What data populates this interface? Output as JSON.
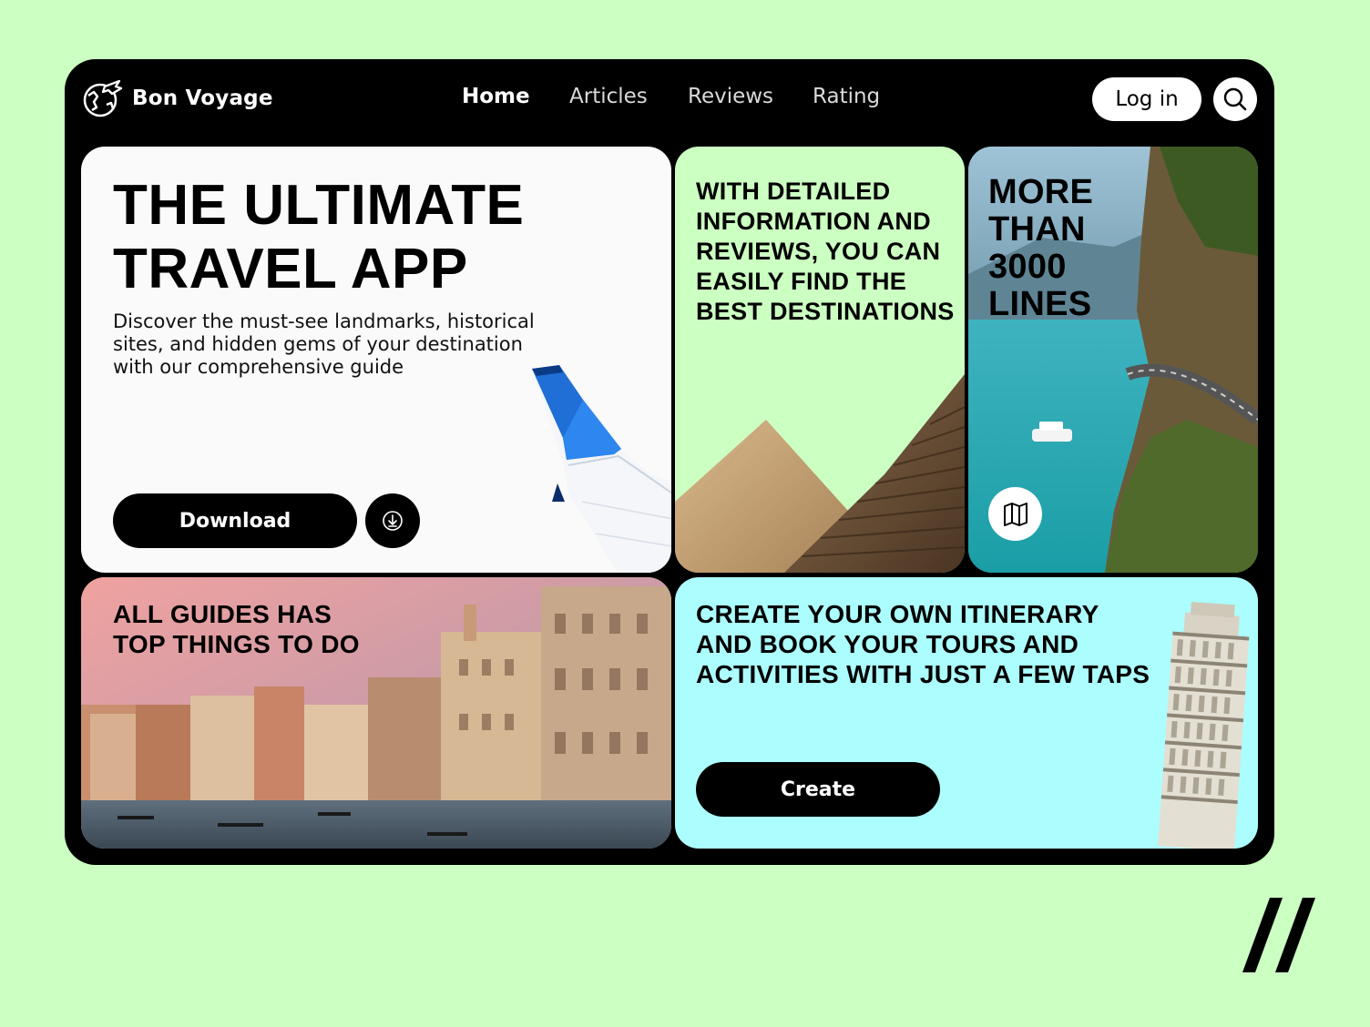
{
  "brand": {
    "name": "Bon Voyage",
    "logo_icon": "globe-plane-icon"
  },
  "nav": {
    "items": [
      {
        "label": "Home",
        "active": true
      },
      {
        "label": "Articles",
        "active": false
      },
      {
        "label": "Reviews",
        "active": false
      },
      {
        "label": "Rating",
        "active": false
      }
    ],
    "login_label": "Log in",
    "search_icon": "search-icon"
  },
  "hero": {
    "title_line1": "THE ULTIMATE",
    "title_line2": "TRAVEL APP",
    "description": "Discover the must-see landmarks, historical sites, and hidden gems of your destination with our comprehensive guide",
    "download_label": "Download",
    "download_icon": "download-icon",
    "image": "airplane-wing"
  },
  "info_card": {
    "text": "WITH DETAILED INFORMATION AND REVIEWS, YOU CAN EASILY FIND THE BEST DESTINATIONS",
    "image": "pyramids"
  },
  "lines_card": {
    "text_line1": "MORE",
    "text_line2": "THAN",
    "text_line3": "3000",
    "text_line4": "LINES",
    "map_icon": "map-icon",
    "image": "coastal-road-lake"
  },
  "guides_card": {
    "text_line1": "ALL GUIDES HAS",
    "text_line2": "TOP THINGS TO DO",
    "image": "venice-canal"
  },
  "itinerary_card": {
    "text_line1": "CREATE YOUR OWN ITINERARY",
    "text_line2": "AND BOOK YOUR TOURS AND",
    "text_line3": "ACTIVITIES WITH JUST A FEW TAPS",
    "create_label": "Create",
    "image": "leaning-tower-of-pisa"
  },
  "colors": {
    "page_background": "#ccffc2",
    "frame": "#000000",
    "hero_card": "#fafafa",
    "info_card": "#ccffc2",
    "itinerary_card": "#acfdfd",
    "button": "#000000",
    "plane_blue": "#1f6fd6"
  },
  "corner_mark": "double-slash-logo"
}
